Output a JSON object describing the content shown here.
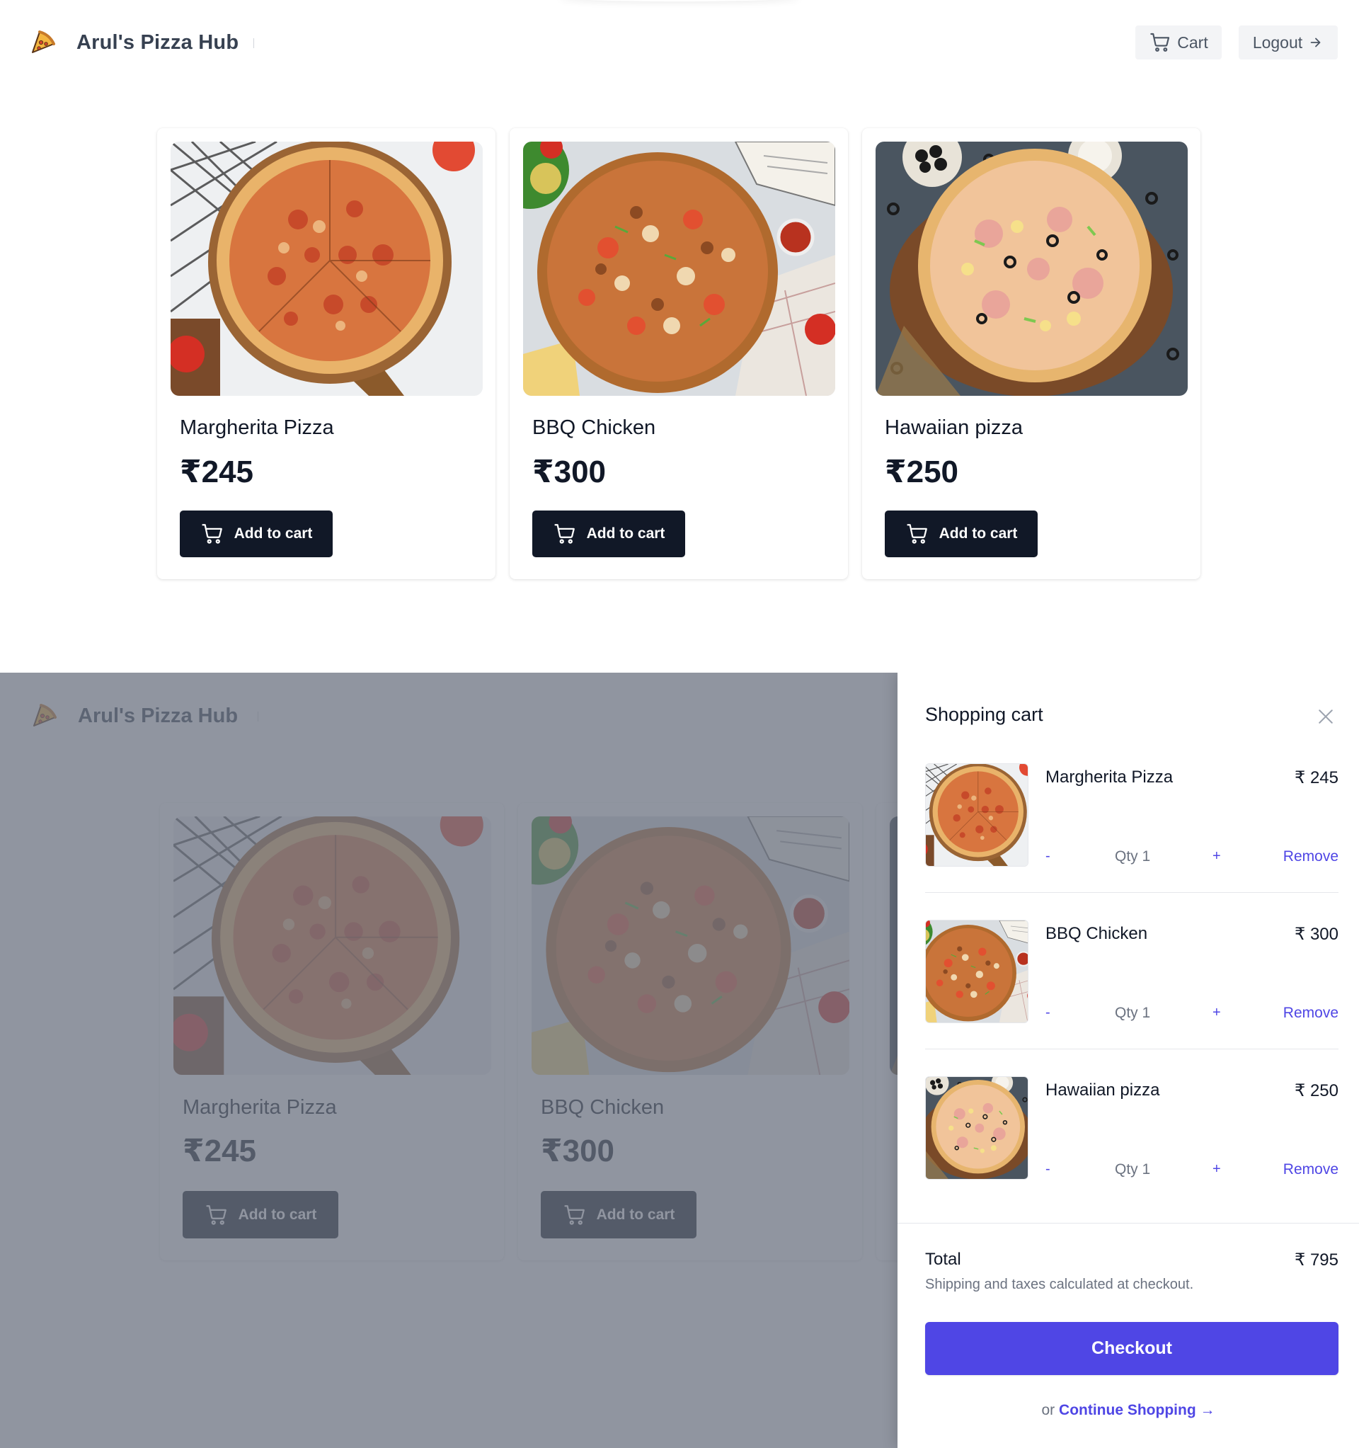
{
  "header": {
    "brand": "Arul's Pizza Hub",
    "cart_label": "Cart",
    "logout_label": "Logout"
  },
  "products": [
    {
      "name": "Margherita Pizza",
      "price": "₹245",
      "button": "Add to cart",
      "image": "margherita"
    },
    {
      "name": "BBQ Chicken",
      "price": "₹300",
      "button": "Add to cart",
      "image": "bbq"
    },
    {
      "name": "Hawaiian pizza",
      "price": "₹250",
      "button": "Add to cart",
      "image": "hawaiian"
    }
  ],
  "cart": {
    "title": "Shopping cart",
    "items": [
      {
        "name": "Margherita Pizza",
        "price": "₹ 245",
        "minus": "-",
        "qty": "Qty 1",
        "plus": "+",
        "remove": "Remove"
      },
      {
        "name": "BBQ Chicken",
        "price": "₹ 300",
        "minus": "-",
        "qty": "Qty 1",
        "plus": "+",
        "remove": "Remove"
      },
      {
        "name": "Hawaiian pizza",
        "price": "₹ 250",
        "minus": "-",
        "qty": "Qty 1",
        "plus": "+",
        "remove": "Remove"
      }
    ],
    "total_label": "Total",
    "total_value": "₹ 795",
    "note": "Shipping and taxes calculated at checkout.",
    "checkout": "Checkout",
    "or": "or",
    "continue": "Continue Shopping →"
  },
  "colors": {
    "dark_button": "#111827",
    "accent": "#4f46e5",
    "overlay": "#6b7280"
  },
  "icons": {
    "logo": "pizza-slice-icon",
    "cart": "shopping-cart-icon",
    "logout": "arrow-right-icon",
    "close": "close-icon"
  }
}
